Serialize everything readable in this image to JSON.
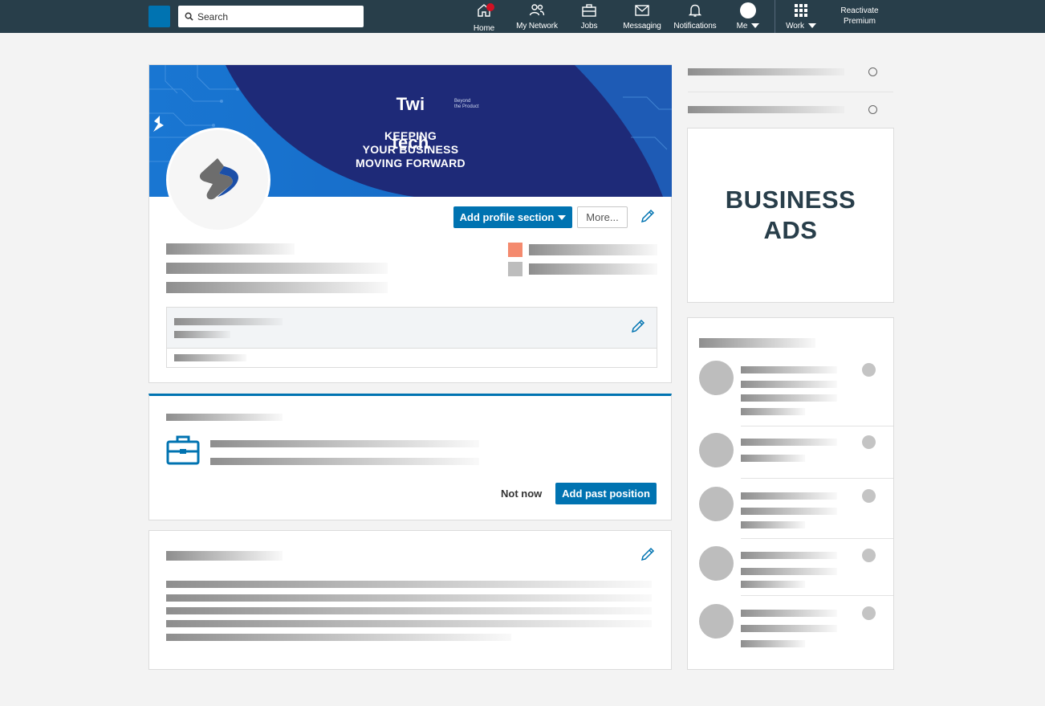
{
  "nav": {
    "search_placeholder": "Search",
    "items": [
      {
        "label": "Home",
        "icon": "home-icon"
      },
      {
        "label": "My Network",
        "icon": "people-icon"
      },
      {
        "label": "Jobs",
        "icon": "briefcase-icon"
      },
      {
        "label": "Messaging",
        "icon": "envelope-icon"
      },
      {
        "label": "Notifications",
        "icon": "bell-icon"
      },
      {
        "label": "Me",
        "icon": "avatar-icon"
      },
      {
        "label": "Work",
        "icon": "grid-icon"
      }
    ],
    "premium_line1": "Reactivate",
    "premium_line2": "Premium"
  },
  "profile": {
    "company_name_left": "Twi",
    "company_name_right": "tech",
    "tagline_line1": "Beyond",
    "tagline_line2": "the Product",
    "slogan_line1": "KEEPING",
    "slogan_line2": "YOUR BUSINESS",
    "slogan_line3": "MOVING FORWARD",
    "add_section_label": "Add profile section",
    "more_label": "More..."
  },
  "experience_prompt": {
    "not_now_label": "Not now",
    "add_past_position_label": "Add past position"
  },
  "ads": {
    "line1": "BUSINESS",
    "line2": "ADS"
  },
  "colors": {
    "nav_bg": "#283e4a",
    "brand_blue": "#0073b1",
    "banner_dark": "#1e2a78",
    "banner_light": "#1565c0",
    "swatch_orange": "#f48a6e",
    "swatch_grey": "#bdbdbd"
  }
}
